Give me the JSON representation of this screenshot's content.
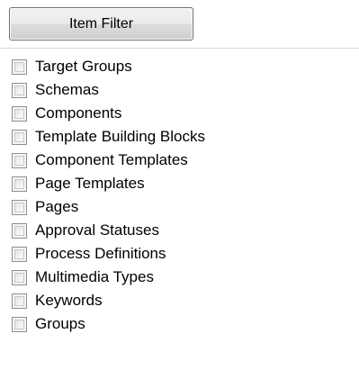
{
  "filter": {
    "button_label": "Item Filter"
  },
  "items": [
    {
      "label": "Target Groups",
      "checked": false
    },
    {
      "label": "Schemas",
      "checked": false
    },
    {
      "label": "Components",
      "checked": false
    },
    {
      "label": "Template Building Blocks",
      "checked": false
    },
    {
      "label": "Component Templates",
      "checked": false
    },
    {
      "label": "Page Templates",
      "checked": false
    },
    {
      "label": "Pages",
      "checked": false
    },
    {
      "label": "Approval Statuses",
      "checked": false
    },
    {
      "label": "Process Definitions",
      "checked": false
    },
    {
      "label": "Multimedia Types",
      "checked": false
    },
    {
      "label": "Keywords",
      "checked": false
    },
    {
      "label": "Groups",
      "checked": false
    }
  ]
}
